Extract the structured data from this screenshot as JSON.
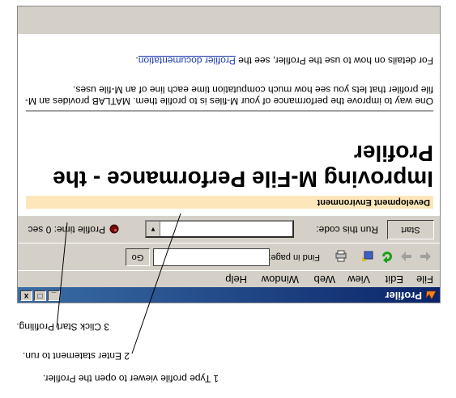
{
  "window": {
    "title": "Profiler",
    "buttons": [
      "_",
      "□",
      "x"
    ]
  },
  "menu": [
    "File",
    "Edit",
    "View",
    "Web",
    "Window",
    "Help"
  ],
  "toolbar": {
    "find_label": "Find in page:",
    "find_value": "",
    "go_label": "Go",
    "icons": [
      "back-arrow-icon",
      "forward-arrow-icon",
      "refresh-icon",
      "home-icon",
      "print-icon"
    ]
  },
  "runbar": {
    "start_label": "Start Profiling",
    "run_label": "Run this code:",
    "run_value": "",
    "profile_time": "Profile time: 0 sec"
  },
  "content": {
    "section": "Development Environment",
    "title": "Improving M-File Performance - the Profiler",
    "para1": "One way to improve the performance of your M-files is to profile them. MATLAB provides an M-file profiler that lets you see how much computation time each line of an M-file uses.",
    "para2_prefix": "For details on how to use the Profiler, see the ",
    "para2_link": "Profiler documentation",
    "para2_suffix": "."
  },
  "callouts": {
    "c3": "3 Click Start Profiling.",
    "c2": "2 Enter statement to run.",
    "c1": "1 Type profile viewer to open the Profiler."
  },
  "colors": {
    "title_bar": "#0a246a",
    "section_band": "#fde7ba",
    "link": "#1f3cb0"
  }
}
